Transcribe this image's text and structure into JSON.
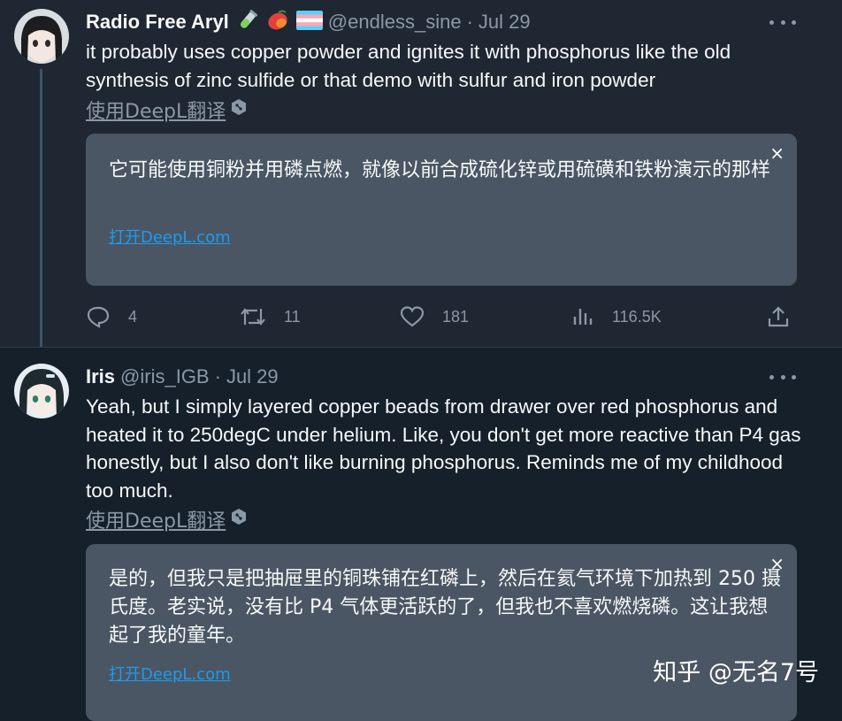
{
  "tweets": [
    {
      "display_name": "Radio Free Aryl",
      "emojis": [
        "test-tube-emoji",
        "mango-emoji",
        "trans-flag-emoji"
      ],
      "handle": "@endless_sine",
      "separator": "·",
      "date": "Jul 29",
      "text": "it probably uses copper powder and ignites it with phosphorus like the old synthesis of zinc sulfide or that demo with sulfur and iron powder",
      "translate_label": "使用DeepL翻译",
      "translation": "它可能使用铜粉并用磷点燃，就像以前合成硫化锌或用硫磺和铁粉演示的那样",
      "open_deepl": "打开DeepL.com",
      "close_glyph": "×",
      "replies": "4",
      "retweets": "11",
      "likes": "181",
      "views": "116.5K"
    },
    {
      "display_name": "Iris",
      "handle": "@iris_IGB",
      "separator": "·",
      "date": "Jul 29",
      "text": "Yeah, but I simply layered copper beads from drawer over red phosphorus and heated it to 250degC under helium. Like, you don't get more reactive than P4 gas honestly, but I also don't like burning phosphorus. Reminds me of my childhood too much.",
      "translate_label": "使用DeepL翻译",
      "translation": "是的，但我只是把抽屉里的铜珠铺在红磷上，然后在氦气环境下加热到 250 摄氏度。老实说，没有比 P4 气体更活跃的了，但我也不喜欢燃烧磷。这让我想起了我的童年。",
      "open_deepl": "打开DeepL.com",
      "close_glyph": "×"
    }
  ],
  "watermark": "知乎 @无名7号",
  "colors": {
    "background": "#15202b",
    "highlight_background": "#1e2732",
    "translation_box": "#4a5663",
    "link": "#1d9bf0",
    "muted": "#8b98a5"
  }
}
